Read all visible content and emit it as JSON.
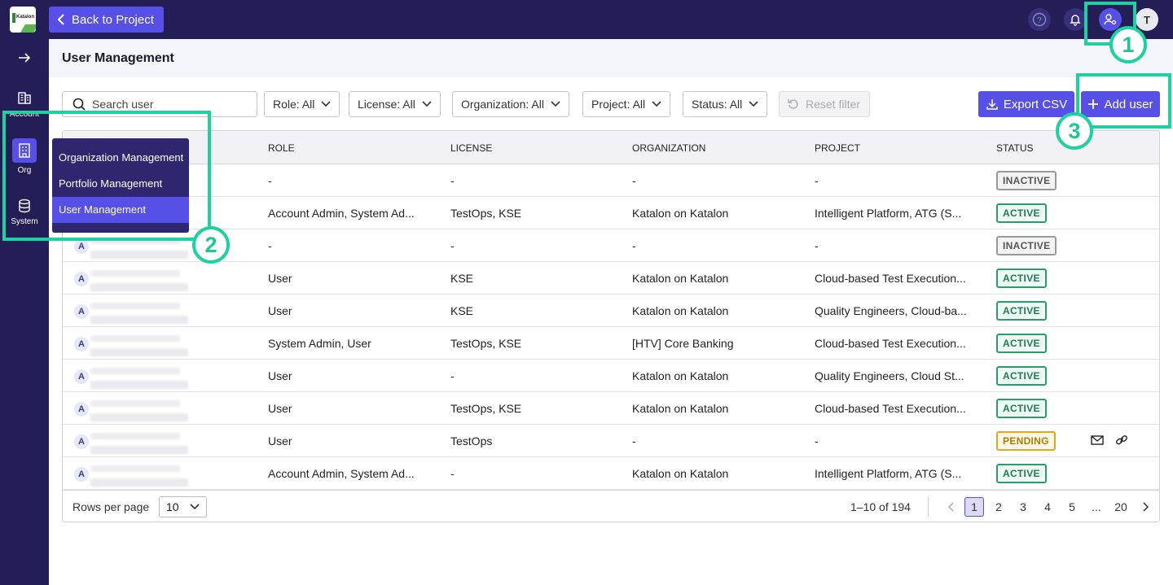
{
  "topbar": {
    "back_label": "Back to Project",
    "avatar_initial": "T"
  },
  "sidebar": {
    "items": [
      {
        "label": "Account",
        "icon": "building-icon"
      },
      {
        "label": "Org",
        "icon": "org-icon"
      },
      {
        "label": "System",
        "icon": "database-icon"
      }
    ],
    "flyout": [
      "Organization Management",
      "Portfolio Management",
      "User Management"
    ]
  },
  "page": {
    "title": "User Management"
  },
  "filters": {
    "search_placeholder": "Search user",
    "role": "Role: All",
    "license": "License: All",
    "organization": "Organization: All",
    "project": "Project: All",
    "status": "Status: All",
    "reset": "Reset filter",
    "export": "Export CSV",
    "add_user": "Add user"
  },
  "table": {
    "columns": [
      "ROLE",
      "LICENSE",
      "ORGANIZATION",
      "PROJECT",
      "STATUS"
    ],
    "rows": [
      {
        "avatar": "",
        "role": "-",
        "license": "-",
        "org": "-",
        "project": "-",
        "status": "INACTIVE"
      },
      {
        "avatar": "",
        "role": "Account Admin, System Ad...",
        "license": "TestOps, KSE",
        "org": "Katalon on Katalon",
        "project": "Intelligent Platform, ATG (S...",
        "status": "ACTIVE"
      },
      {
        "avatar": "A",
        "role": "-",
        "license": "-",
        "org": "-",
        "project": "-",
        "status": "INACTIVE"
      },
      {
        "avatar": "A",
        "role": "User",
        "license": "KSE",
        "org": "Katalon on Katalon",
        "project": "Cloud-based Test Execution...",
        "status": "ACTIVE"
      },
      {
        "avatar": "A",
        "role": "User",
        "license": "KSE",
        "org": "Katalon on Katalon",
        "project": "Quality Engineers, Cloud-ba...",
        "status": "ACTIVE"
      },
      {
        "avatar": "A",
        "role": "System Admin, User",
        "license": "TestOps, KSE",
        "org": "[HTV] Core Banking",
        "project": "Cloud-based Test Execution...",
        "status": "ACTIVE"
      },
      {
        "avatar": "A",
        "role": "User",
        "license": "-",
        "org": "Katalon on Katalon",
        "project": "Quality Engineers, Cloud St...",
        "status": "ACTIVE"
      },
      {
        "avatar": "A",
        "role": "User",
        "license": "TestOps, KSE",
        "org": "Katalon on Katalon",
        "project": "Cloud-based Test Execution...",
        "status": "ACTIVE"
      },
      {
        "avatar": "A",
        "role": "User",
        "license": "TestOps",
        "org": "-",
        "project": "-",
        "status": "PENDING"
      },
      {
        "avatar": "A",
        "role": "Account Admin, System Ad...",
        "license": "-",
        "org": "Katalon on Katalon",
        "project": "Intelligent Platform, ATG (S...",
        "status": "ACTIVE"
      }
    ]
  },
  "pagination": {
    "rows_per_page_label": "Rows per page",
    "rows_per_page": "10",
    "range": "1–10 of 194",
    "pages": [
      "1",
      "2",
      "3",
      "4",
      "5",
      "...",
      "20"
    ],
    "current": "1"
  },
  "callouts": [
    "1",
    "2",
    "3"
  ],
  "colors": {
    "accent": "#5650e6",
    "nav": "#241e57",
    "highlight": "#1fd1a0"
  }
}
